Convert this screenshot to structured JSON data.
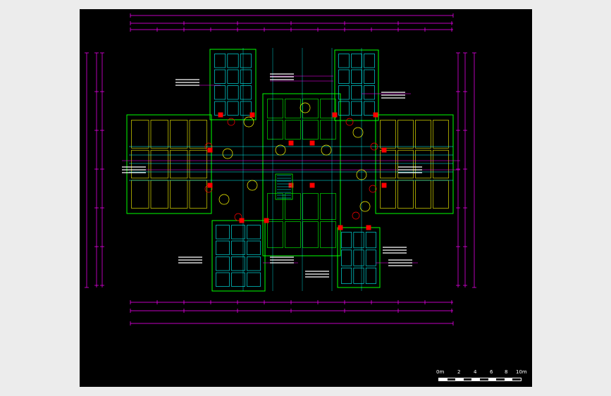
{
  "viewer": {
    "background": "#000000",
    "page_background": "#ececec"
  },
  "colors": {
    "walls": "#00ff00",
    "partitions": "#ffff00",
    "dimensions": "#ff00ff",
    "furniture": "#00ffff",
    "columns": "#ff0000",
    "text": "#ffffff",
    "grid": "#00ffff"
  },
  "scale_bar": {
    "labels": [
      "0m",
      "2",
      "4",
      "6",
      "8",
      "10m"
    ]
  }
}
